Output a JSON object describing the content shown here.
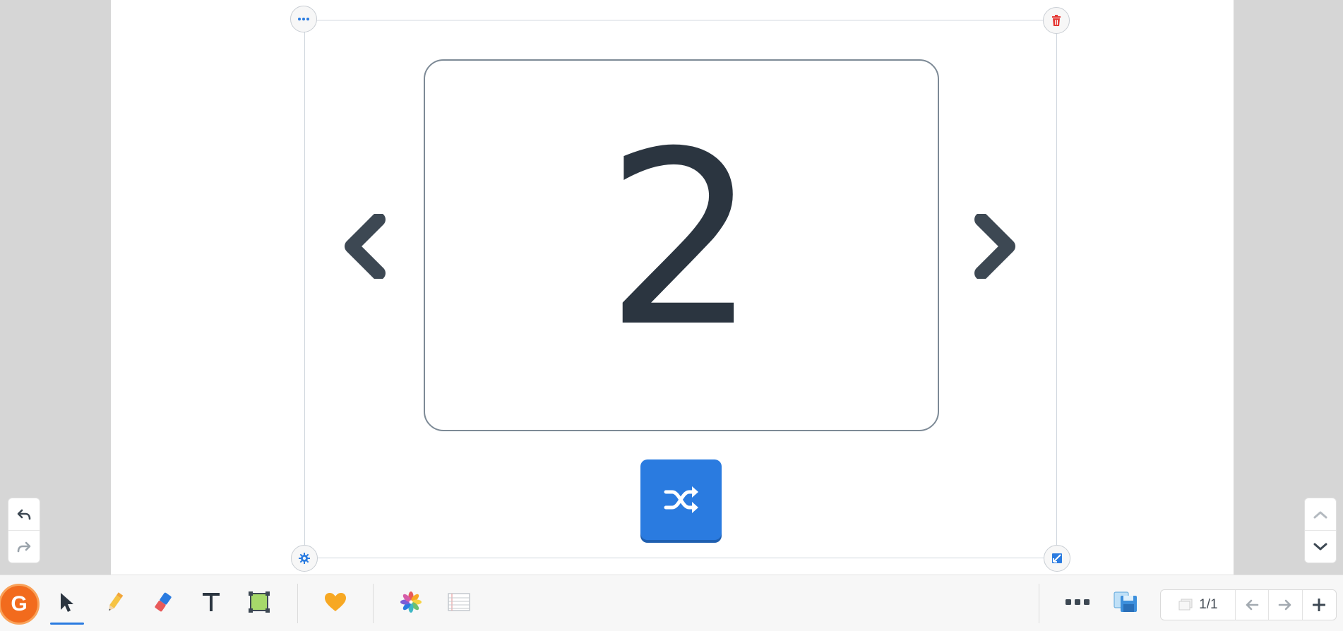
{
  "card": {
    "current_number": "2"
  },
  "frame": {
    "menu_icon": "more-dots-icon",
    "delete_icon": "trash-icon",
    "settings_icon": "gear-icon",
    "resize_icon": "resize-icon"
  },
  "navigation": {
    "prev_icon": "chevron-left-icon",
    "next_icon": "chevron-right-icon"
  },
  "shuffle": {
    "icon": "shuffle-icon",
    "color": "#2a7be0"
  },
  "history": {
    "undo_icon": "undo-icon",
    "redo_icon": "redo-icon"
  },
  "scroll": {
    "up_icon": "chevron-up-icon",
    "down_icon": "chevron-down-icon"
  },
  "toolbar": {
    "logo_letter": "G",
    "tools": [
      {
        "name": "select",
        "icon": "cursor-icon",
        "active": true
      },
      {
        "name": "pen",
        "icon": "pencil-icon"
      },
      {
        "name": "eraser",
        "icon": "eraser-icon"
      },
      {
        "name": "text",
        "icon": "text-icon"
      },
      {
        "name": "shape",
        "icon": "shape-icon"
      },
      {
        "name": "favorites",
        "icon": "heart-icon"
      },
      {
        "name": "widgets",
        "icon": "pinwheel-icon"
      },
      {
        "name": "background",
        "icon": "lined-paper-icon"
      }
    ],
    "more_icon": "more-horizontal-icon",
    "save_icon": "save-icon"
  },
  "pagination": {
    "counter": "1/1",
    "pages_icon": "pages-icon",
    "prev_icon": "arrow-left-icon",
    "next_icon": "arrow-right-icon",
    "add_icon": "plus-icon"
  },
  "colors": {
    "accent": "#2a7be0",
    "brand": "#f26b1d",
    "danger": "#e53935",
    "text_dark": "#2b3540"
  }
}
